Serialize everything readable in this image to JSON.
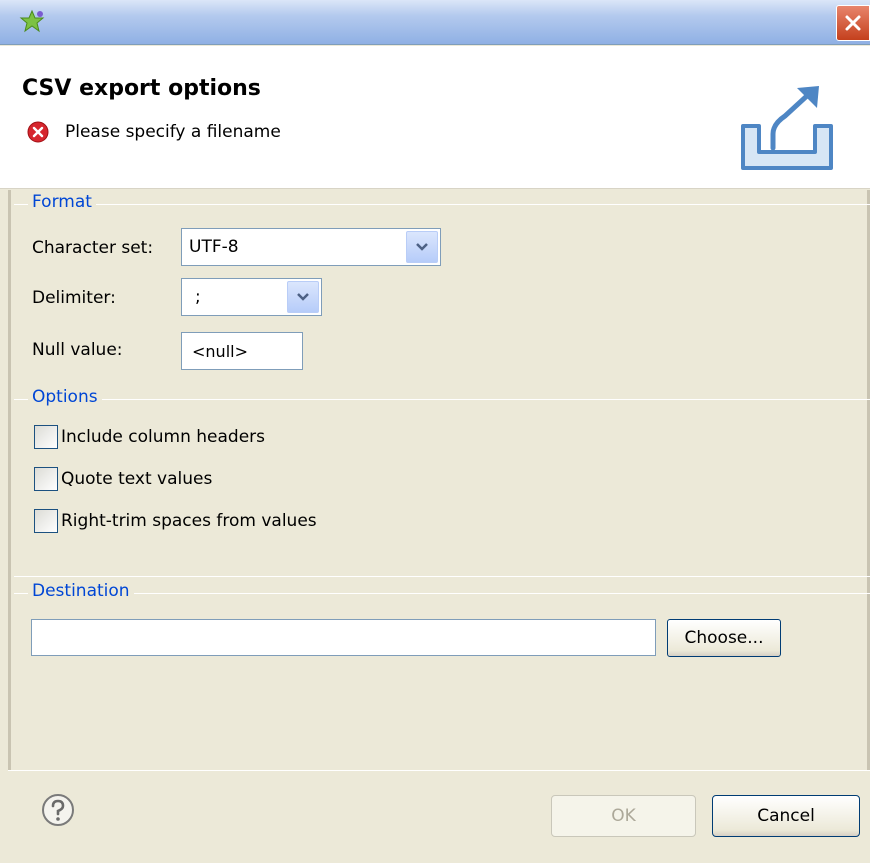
{
  "window": {
    "title": ""
  },
  "header": {
    "title": "CSV export options",
    "error_message": "Please specify a filename"
  },
  "format": {
    "group_label": "Format",
    "charset_label": "Character set:",
    "charset_value": "UTF-8",
    "delimiter_label": "Delimiter:",
    "delimiter_value": ";",
    "null_label": "Null value:",
    "null_value": "<null>"
  },
  "options": {
    "group_label": "Options",
    "items": [
      {
        "label": "Include column headers",
        "checked": false
      },
      {
        "label": "Quote text values",
        "checked": false
      },
      {
        "label": "Right-trim spaces from values",
        "checked": false
      }
    ]
  },
  "destination": {
    "group_label": "Destination",
    "path_value": "",
    "choose_label": "Choose..."
  },
  "footer": {
    "ok_label": "OK",
    "cancel_label": "Cancel"
  },
  "colors": {
    "group_label": "#0046d5",
    "error": "#d6262e",
    "close_button": "#c4401d"
  }
}
